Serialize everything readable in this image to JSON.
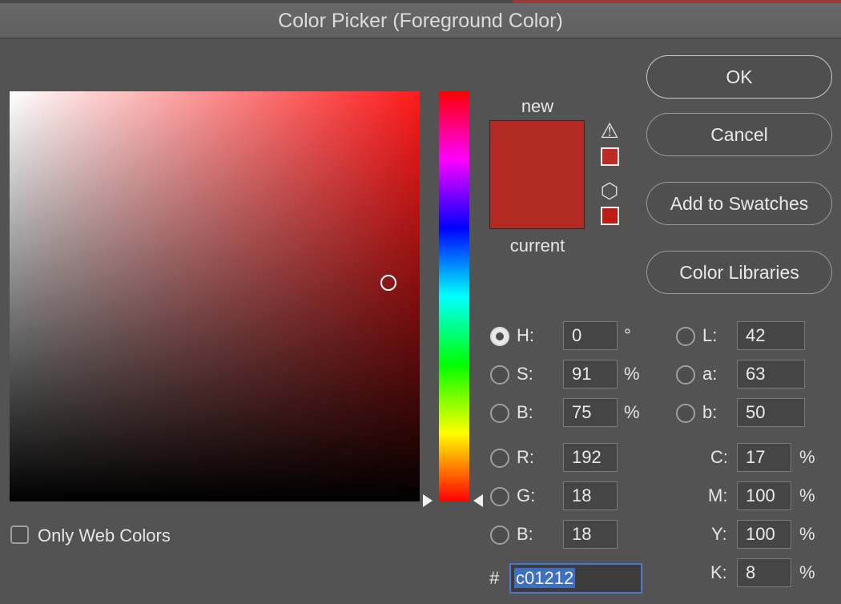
{
  "window": {
    "title": "Color Picker (Foreground Color)"
  },
  "preview": {
    "new_label": "new",
    "current_label": "current",
    "new_color": "#b32a22",
    "current_color": "#b32a22",
    "gamut_warning_icon": "warning-triangle-icon",
    "web_safe_icon": "cube-icon",
    "gamut_swatch_color": "#bd2a24",
    "web_swatch_color": "#bd1b16"
  },
  "buttons": {
    "ok": "OK",
    "cancel": "Cancel",
    "add_to_swatches": "Add to Swatches",
    "color_libraries": "Color Libraries"
  },
  "hsb": [
    {
      "label": "H:",
      "value": "0",
      "unit": "°",
      "selected": true
    },
    {
      "label": "S:",
      "value": "91",
      "unit": "%",
      "selected": false
    },
    {
      "label": "B:",
      "value": "75",
      "unit": "%",
      "selected": false
    }
  ],
  "lab": [
    {
      "label": "L:",
      "value": "42"
    },
    {
      "label": "a:",
      "value": "63"
    },
    {
      "label": "b:",
      "value": "50"
    }
  ],
  "rgb": [
    {
      "label": "R:",
      "value": "192"
    },
    {
      "label": "G:",
      "value": "18"
    },
    {
      "label": "B:",
      "value": "18"
    }
  ],
  "cmyk": [
    {
      "label": "C:",
      "value": "17",
      "unit": "%"
    },
    {
      "label": "M:",
      "value": "100",
      "unit": "%"
    },
    {
      "label": "Y:",
      "value": "100",
      "unit": "%"
    },
    {
      "label": "K:",
      "value": "8",
      "unit": "%"
    }
  ],
  "hex": {
    "prefix": "#",
    "value": "c01212"
  },
  "web_colors": {
    "label": "Only Web Colors",
    "checked": false
  }
}
